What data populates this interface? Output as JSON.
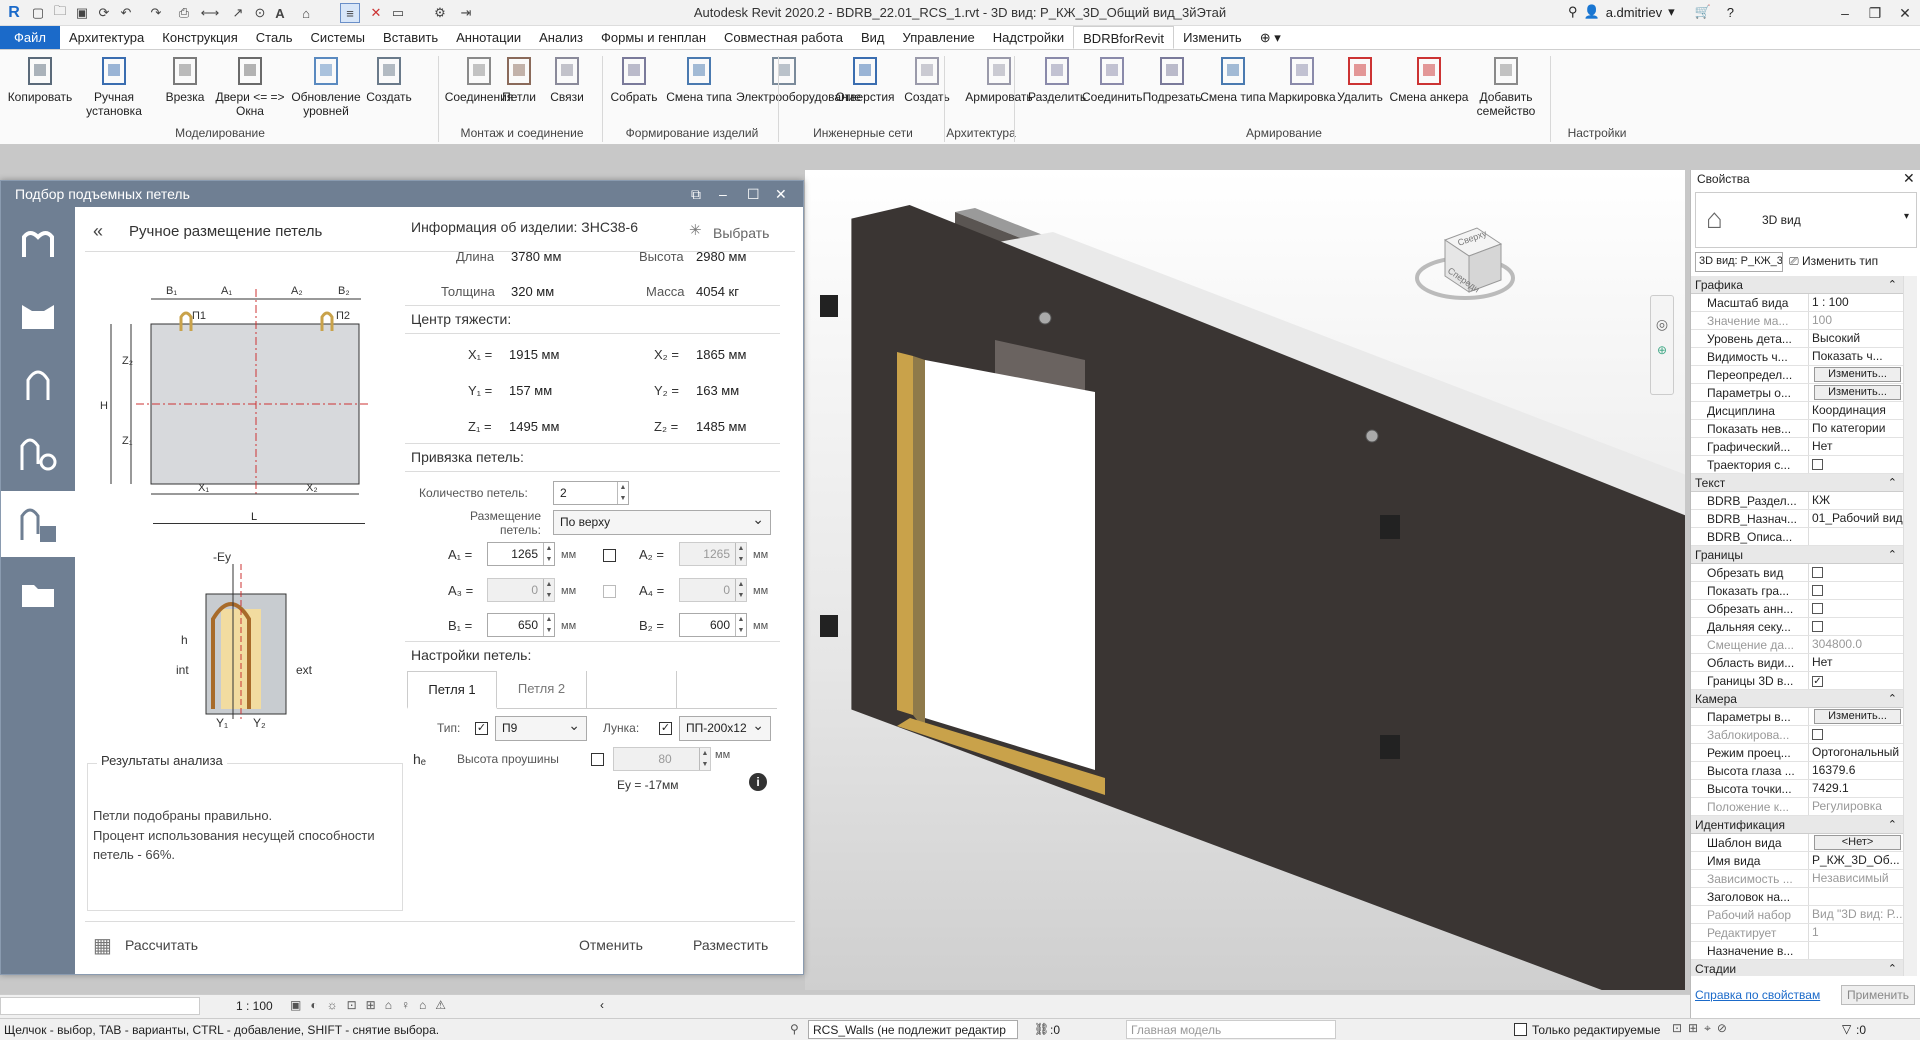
{
  "titlebar": {
    "title": "Autodesk Revit 2020.2 - BDRB_22.01_RCS_1.rvt - 3D вид: Р_КЖ_3D_Общий вид_3йЭтай",
    "user": "a.dmitriev"
  },
  "tabs": [
    "Файл",
    "Архитектура",
    "Конструкция",
    "Сталь",
    "Системы",
    "Вставить",
    "Аннотации",
    "Анализ",
    "Формы и генплан",
    "Совместная работа",
    "Вид",
    "Управление",
    "Надстройки",
    "BDRBforRevit",
    "Изменить"
  ],
  "ribbon": {
    "buttons": [
      "Копировать",
      "Ручная установка",
      "Врезка",
      "Двери <= => Окна",
      "Обновление уровней",
      "Создать",
      "Соединения",
      "Петли",
      "Связи",
      "Собрать",
      "Смена типа",
      "Электрооборудование",
      "Отверстия",
      "Создать",
      "Армировать",
      "Разделить",
      "Соединить",
      "Подрезать",
      "Смена типа",
      "Маркировка",
      "Удалить",
      "Смена анкера",
      "Добавить семейство"
    ],
    "groups": [
      "Моделирование",
      "Монтаж и соединение",
      "Формирование изделий",
      "Инженерные сети",
      "Архитектура",
      "Армирование",
      "Настройки"
    ]
  },
  "dialog": {
    "title": "Подбор подъемных петель",
    "heading": "Ручное размещение петель",
    "select_btn": "Выбрать",
    "info_header": "Информация об изделии: ЗНС38-6",
    "length_label": "Длина",
    "length_val": "3780 мм",
    "height_label": "Высота",
    "height_val": "2980 мм",
    "thick_label": "Толщина",
    "thick_val": "320 мм",
    "mass_label": "Масса",
    "mass_val": "4054 кг",
    "cg_header": "Центр тяжести:",
    "x1": "X₁ =",
    "x1v": "1915 мм",
    "x2": "X₂ =",
    "x2v": "1865 мм",
    "y1": "Y₁ =",
    "y1v": "157 мм",
    "y2": "Y₂ =",
    "y2v": "163 мм",
    "z1": "Z₁ =",
    "z1v": "1495 мм",
    "z2": "Z₂ =",
    "z2v": "1485 мм",
    "bind_header": "Привязка петель:",
    "count_label": "Количество петель:",
    "count_val": "2",
    "place_label": "Размещение петель:",
    "place_val": "По верху",
    "a1": "A₁ =",
    "a1v": "1265",
    "a2": "A₂ =",
    "a2v": "1265",
    "a3": "A₃ =",
    "a3v": "0",
    "a4": "A₄ =",
    "a4v": "0",
    "b1": "B₁ =",
    "b1v": "650",
    "b2": "B₂ =",
    "b2v": "600",
    "unit": "мм",
    "settings_header": "Настройки петель:",
    "tab1": "Петля 1",
    "tab2": "Петля 2",
    "type_label": "Тип:",
    "type_val": "П9",
    "hole_label": "Лунка:",
    "hole_val": "ПП-200х12",
    "he_label": "hₑ",
    "eye_label": "Высота проушины",
    "eye_val": "80",
    "ey_text": "Ey = -17мм",
    "results_title": "Результаты анализа",
    "results_text1": "Петли подобраны правильно.",
    "results_text2": "Процент использования несущей способности петель - 66%.",
    "calc_btn": "Рассчитать",
    "cancel_btn": "Отменить",
    "place_btn": "Разместить",
    "diagram": {
      "b1": "B₁",
      "a1": "A₁",
      "a2": "A₂",
      "b2": "B₂",
      "p1": "П1",
      "p2": "П2",
      "h": "H",
      "z2": "Z₂",
      "z1": "Z₁",
      "x1": "X₁",
      "x2": "X₂",
      "l": "L",
      "ey": "-Ey",
      "int": "int",
      "ext": "ext",
      "y1": "Y₁",
      "y2": "Y₂",
      "h_small": "h"
    }
  },
  "properties": {
    "title": "Свойства",
    "type_name": "3D вид",
    "selector": "3D вид: Р_КЖ_3",
    "edit_type": "Изменить тип",
    "help": "Справка по свойствам",
    "apply": "Применить",
    "sections": [
      {
        "name": "Графика",
        "rows": [
          [
            "Масштаб вида",
            "1 : 100",
            ""
          ],
          [
            "Значение ма...",
            "100",
            "dim"
          ],
          [
            "Уровень дета...",
            "Высокий",
            ""
          ],
          [
            "Видимость ч...",
            "Показать ч...",
            ""
          ],
          [
            "Переопредел...",
            "Изменить...",
            "btn"
          ],
          [
            "Параметры о...",
            "Изменить...",
            "btn"
          ],
          [
            "Дисциплина",
            "Координация",
            ""
          ],
          [
            "Показать нев...",
            "По категории",
            ""
          ],
          [
            "Графический...",
            "Нет",
            ""
          ],
          [
            "Траектория с...",
            "",
            ""
          ]
        ]
      },
      {
        "name": "Текст",
        "rows": [
          [
            "BDRB_Раздел...",
            "КЖ",
            ""
          ],
          [
            "BDRB_Назнач...",
            "01_Рабочий вид",
            ""
          ],
          [
            "BDRB_Описа...",
            "",
            ""
          ]
        ]
      },
      {
        "name": "Границы",
        "rows": [
          [
            "Обрезать вид",
            "",
            ""
          ],
          [
            "Показать гра...",
            "",
            ""
          ],
          [
            "Обрезать анн...",
            "",
            ""
          ],
          [
            "Дальняя секу...",
            "",
            ""
          ],
          [
            "Смещение да...",
            "304800.0",
            "dim"
          ],
          [
            "Область види...",
            "Нет",
            ""
          ],
          [
            "Границы 3D в...",
            "✓",
            ""
          ]
        ]
      },
      {
        "name": "Камера",
        "rows": [
          [
            "Параметры в...",
            "Изменить...",
            "btn"
          ],
          [
            "Заблокирова...",
            "",
            "dim"
          ],
          [
            "Режим проец...",
            "Ортогональный",
            ""
          ],
          [
            "Высота глаза ...",
            "16379.6",
            ""
          ],
          [
            "Высота точки...",
            "7429.1",
            ""
          ],
          [
            "Положение к...",
            "Регулировка",
            "dim"
          ]
        ]
      },
      {
        "name": "Идентификация",
        "rows": [
          [
            "Шаблон вида",
            "<Нет>",
            "btn"
          ],
          [
            "Имя вида",
            "Р_КЖ_3D_Об...",
            ""
          ],
          [
            "Зависимость ...",
            "Независимый",
            "dim"
          ],
          [
            "Заголовок на...",
            "",
            ""
          ],
          [
            "Рабочий набор",
            "Вид \"3D вид: Р...",
            "dim"
          ],
          [
            "Редактирует",
            "1",
            "dim"
          ],
          [
            "Назначение в...",
            "",
            ""
          ]
        ]
      },
      {
        "name": "Стадии",
        "rows": []
      }
    ]
  },
  "viewbar": {
    "scale": "1 : 100"
  },
  "status": {
    "hint": "Щелчок - выбор, TAB - варианты, CTRL - добавление, SHIFT - снятие выбора.",
    "workset": "RCS_Walls (не подлежит редактир",
    "zero1": ":0",
    "model": "Главная модель",
    "only_edit": "Только редактируемые",
    "zero2": ":0"
  },
  "viewcube": {
    "top": "Сверху",
    "front": "Спереди"
  },
  "colors": {
    "accent": "#1b6ac9",
    "dialog_header": "#6f7f93",
    "panel": "#3a3533",
    "insulation": "#c9a24a"
  }
}
